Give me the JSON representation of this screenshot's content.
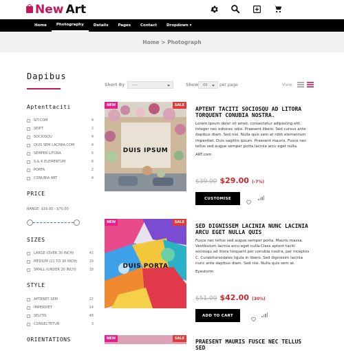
{
  "header": {
    "logo_new": "New",
    "logo_art": "Art",
    "icons": [
      "gear-icon",
      "search-icon",
      "plus-square-icon",
      "cart-icon"
    ]
  },
  "nav": {
    "items": [
      {
        "label": "Home"
      },
      {
        "label": "Photography",
        "active": true
      },
      {
        "label": "Details"
      },
      {
        "label": "Pages"
      },
      {
        "label": "Contact"
      },
      {
        "label": "Dropdown ▾"
      }
    ]
  },
  "breadcrumb": "Home > Photograph",
  "sidebar": {
    "title": "Dapibus",
    "sections": {
      "categories_title": "Aptenttaciti",
      "categories": [
        {
          "label": "SIT.COM",
          "count": "4"
        },
        {
          "label": "SEIPT",
          "count": "2"
        },
        {
          "label": "SOCIOSQU",
          "count": "4"
        },
        {
          "label": "QUIS SEM LACINIA.COM",
          "count": "4"
        },
        {
          "label": "SEMPER LITORA",
          "count": "5"
        },
        {
          "label": "S.& K ELEMENTUM",
          "count": "6"
        },
        {
          "label": "PORTA",
          "count": "2"
        },
        {
          "label": "CONUBIA ART",
          "count": "4"
        }
      ],
      "price_title": "PRICE",
      "price_range": "RANGE: $16.00 - $70.00",
      "sizes_title": "SIZES",
      "sizes": [
        {
          "label": "LARGE (OVER 30 INCH)",
          "count": "42"
        },
        {
          "label": "MEDIUM (21 TO 30 INCH)",
          "count": "19"
        },
        {
          "label": "SMALL (UNDER 20 INCH)",
          "count": "18"
        }
      ],
      "style_title": "STYLE",
      "styles": [
        {
          "label": "APTENET SEM",
          "count": "22"
        },
        {
          "label": "IMPERDIET",
          "count": "14"
        },
        {
          "label": "SELITIS",
          "count": "48"
        },
        {
          "label": "CONSECTETUR",
          "count": "3"
        }
      ],
      "orientations_title": "ORIENTATIONS"
    }
  },
  "toolbar": {
    "sort_label": "Short By",
    "sort_value": "----",
    "show_label": "Show",
    "show_value": "09",
    "per_page": "per page",
    "view_label": "View:"
  },
  "products": [
    {
      "badge_new": "NEW",
      "badge_sale": "SALE",
      "watermark": "DUIS IPSUM",
      "title": "Aptent taciti sociosqu ad litora torquent conubia nostra.",
      "desc": "Lorem ipsum dolor sit amet, consectetur adipiscing elit. Integer nec odionec odio. Praesent libero. Sed cursus ante dapibus diam. Sed nisi. Nulla quis sem at nibh elementum imperdiet. Duis sagittis ipsum. Praesent mauris. Fusce nec tellus sed augue semper porta lacinia arcu eget nulla.",
      "brand": "ART.com",
      "old_price": "$39.00",
      "new_price": "$29.00",
      "discount": "(-7%)",
      "button": "CUSTOMISE"
    },
    {
      "badge_new": "NEW",
      "badge_sale": "SALE",
      "watermark": "DUIS PORTA",
      "title": "Sed dignissem lacinia nunc lacinia arcu eget nulla quis",
      "desc": "Fusce nec tellus sed augue semper porta. Mauris massa. Vestibulum lacinia arcu eget nulla.Class aptent taciti sociosqu ad litora torquent per conubia nostra, per inceptos C. Curabitursodales ligula in libero. Sed dignissim lacinia nunc ante dapibus diam. Sed nisi. Nulla quis sem at.",
      "brand": "Eyestorm",
      "old_price": "$51.00",
      "new_price": "$42.00",
      "discount": "(30%)",
      "button": "ADD TO CART"
    },
    {
      "badge_new": "NEW",
      "badge_sale": "SALE",
      "title": "Praesent mauris fusce nec tellus sed"
    }
  ],
  "colors": {
    "brand": "#c2185b",
    "sale_red": "#c62828",
    "nav_bg": "#000000"
  }
}
